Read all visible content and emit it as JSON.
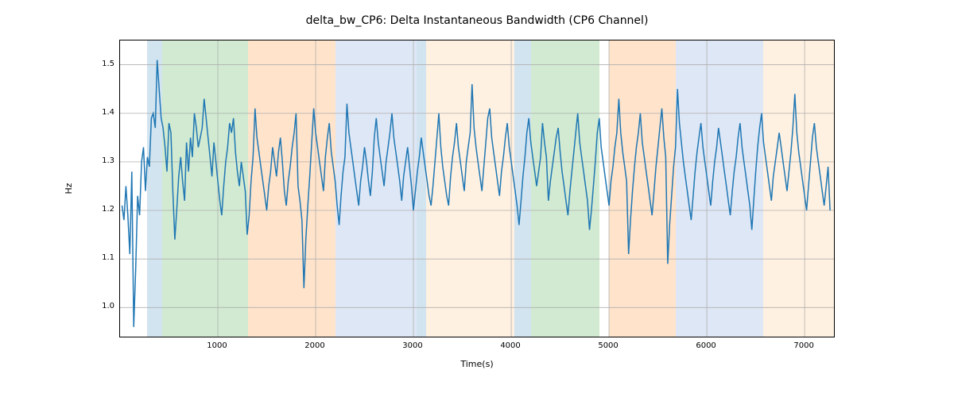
{
  "chart_data": {
    "type": "line",
    "title": "delta_bw_CP6: Delta Instantaneous Bandwidth (CP6 Channel)",
    "xlabel": "Time(s)",
    "ylabel": "Hz",
    "xlim": [
      0,
      7300
    ],
    "ylim": [
      0.94,
      1.55
    ],
    "xticks": [
      1000,
      2000,
      3000,
      4000,
      5000,
      6000,
      7000
    ],
    "yticks": [
      1.0,
      1.1,
      1.2,
      1.3,
      1.4,
      1.5
    ],
    "background_spans": [
      {
        "start": 280,
        "end": 430,
        "color": "blue"
      },
      {
        "start": 430,
        "end": 1310,
        "color": "green"
      },
      {
        "start": 1310,
        "end": 1460,
        "color": "orange"
      },
      {
        "start": 1460,
        "end": 2200,
        "color": "orange"
      },
      {
        "start": 2200,
        "end": 3030,
        "color": "ltblue"
      },
      {
        "start": 3030,
        "end": 3130,
        "color": "blue"
      },
      {
        "start": 3130,
        "end": 4030,
        "color": "cream"
      },
      {
        "start": 4030,
        "end": 4200,
        "color": "blue"
      },
      {
        "start": 4200,
        "end": 4900,
        "color": "green"
      },
      {
        "start": 5000,
        "end": 5680,
        "color": "orange"
      },
      {
        "start": 5680,
        "end": 5780,
        "color": "ltblue"
      },
      {
        "start": 5780,
        "end": 6580,
        "color": "ltblue"
      },
      {
        "start": 6580,
        "end": 7300,
        "color": "cream"
      }
    ],
    "series": [
      {
        "name": "delta_bw_CP6",
        "x_step": 20,
        "x_start": 20,
        "values": [
          1.21,
          1.18,
          1.25,
          1.19,
          1.11,
          1.28,
          0.96,
          1.08,
          1.23,
          1.19,
          1.3,
          1.33,
          1.24,
          1.31,
          1.29,
          1.39,
          1.4,
          1.37,
          1.51,
          1.45,
          1.39,
          1.37,
          1.33,
          1.28,
          1.38,
          1.36,
          1.24,
          1.14,
          1.2,
          1.27,
          1.31,
          1.26,
          1.22,
          1.34,
          1.28,
          1.35,
          1.31,
          1.4,
          1.37,
          1.33,
          1.35,
          1.37,
          1.43,
          1.39,
          1.35,
          1.31,
          1.27,
          1.34,
          1.3,
          1.26,
          1.22,
          1.19,
          1.25,
          1.3,
          1.33,
          1.38,
          1.36,
          1.39,
          1.32,
          1.28,
          1.25,
          1.3,
          1.27,
          1.24,
          1.15,
          1.19,
          1.26,
          1.31,
          1.41,
          1.35,
          1.32,
          1.29,
          1.26,
          1.23,
          1.2,
          1.25,
          1.28,
          1.33,
          1.3,
          1.27,
          1.32,
          1.35,
          1.3,
          1.24,
          1.21,
          1.26,
          1.29,
          1.33,
          1.36,
          1.4,
          1.25,
          1.22,
          1.18,
          1.04,
          1.14,
          1.21,
          1.27,
          1.34,
          1.41,
          1.36,
          1.33,
          1.3,
          1.27,
          1.24,
          1.31,
          1.35,
          1.38,
          1.32,
          1.29,
          1.26,
          1.21,
          1.17,
          1.23,
          1.28,
          1.31,
          1.42,
          1.36,
          1.33,
          1.3,
          1.27,
          1.24,
          1.21,
          1.26,
          1.29,
          1.33,
          1.3,
          1.26,
          1.23,
          1.28,
          1.35,
          1.39,
          1.34,
          1.31,
          1.28,
          1.25,
          1.3,
          1.33,
          1.36,
          1.4,
          1.35,
          1.32,
          1.29,
          1.26,
          1.22,
          1.27,
          1.3,
          1.33,
          1.29,
          1.25,
          1.2,
          1.24,
          1.28,
          1.31,
          1.35,
          1.32,
          1.29,
          1.26,
          1.23,
          1.21,
          1.25,
          1.3,
          1.35,
          1.4,
          1.33,
          1.29,
          1.26,
          1.23,
          1.21,
          1.27,
          1.31,
          1.34,
          1.38,
          1.33,
          1.3,
          1.27,
          1.24,
          1.3,
          1.33,
          1.36,
          1.46,
          1.37,
          1.33,
          1.3,
          1.27,
          1.24,
          1.29,
          1.34,
          1.39,
          1.41,
          1.35,
          1.32,
          1.29,
          1.26,
          1.23,
          1.28,
          1.31,
          1.35,
          1.38,
          1.33,
          1.3,
          1.27,
          1.24,
          1.21,
          1.17,
          1.22,
          1.27,
          1.31,
          1.36,
          1.39,
          1.34,
          1.31,
          1.28,
          1.25,
          1.28,
          1.31,
          1.38,
          1.34,
          1.31,
          1.22,
          1.26,
          1.29,
          1.32,
          1.35,
          1.37,
          1.32,
          1.28,
          1.25,
          1.22,
          1.19,
          1.24,
          1.28,
          1.32,
          1.36,
          1.4,
          1.34,
          1.31,
          1.28,
          1.25,
          1.22,
          1.16,
          1.2,
          1.25,
          1.3,
          1.36,
          1.39,
          1.33,
          1.3,
          1.27,
          1.24,
          1.21,
          1.26,
          1.29,
          1.33,
          1.36,
          1.43,
          1.36,
          1.32,
          1.29,
          1.26,
          1.11,
          1.18,
          1.24,
          1.29,
          1.33,
          1.36,
          1.4,
          1.34,
          1.31,
          1.28,
          1.25,
          1.22,
          1.19,
          1.24,
          1.29,
          1.33,
          1.37,
          1.41,
          1.35,
          1.31,
          1.09,
          1.17,
          1.23,
          1.29,
          1.33,
          1.45,
          1.38,
          1.34,
          1.3,
          1.27,
          1.24,
          1.21,
          1.18,
          1.23,
          1.28,
          1.32,
          1.35,
          1.38,
          1.33,
          1.3,
          1.27,
          1.24,
          1.21,
          1.26,
          1.3,
          1.33,
          1.37,
          1.34,
          1.31,
          1.28,
          1.25,
          1.22,
          1.19,
          1.24,
          1.28,
          1.31,
          1.35,
          1.38,
          1.33,
          1.3,
          1.27,
          1.24,
          1.21,
          1.16,
          1.22,
          1.28,
          1.33,
          1.37,
          1.4,
          1.34,
          1.31,
          1.28,
          1.25,
          1.22,
          1.27,
          1.3,
          1.33,
          1.36,
          1.33,
          1.3,
          1.27,
          1.24,
          1.28,
          1.32,
          1.37,
          1.44,
          1.36,
          1.32,
          1.29,
          1.26,
          1.23,
          1.2,
          1.25,
          1.3,
          1.35,
          1.38,
          1.33,
          1.3,
          1.27,
          1.24,
          1.21,
          1.25,
          1.29,
          1.2
        ]
      }
    ]
  }
}
